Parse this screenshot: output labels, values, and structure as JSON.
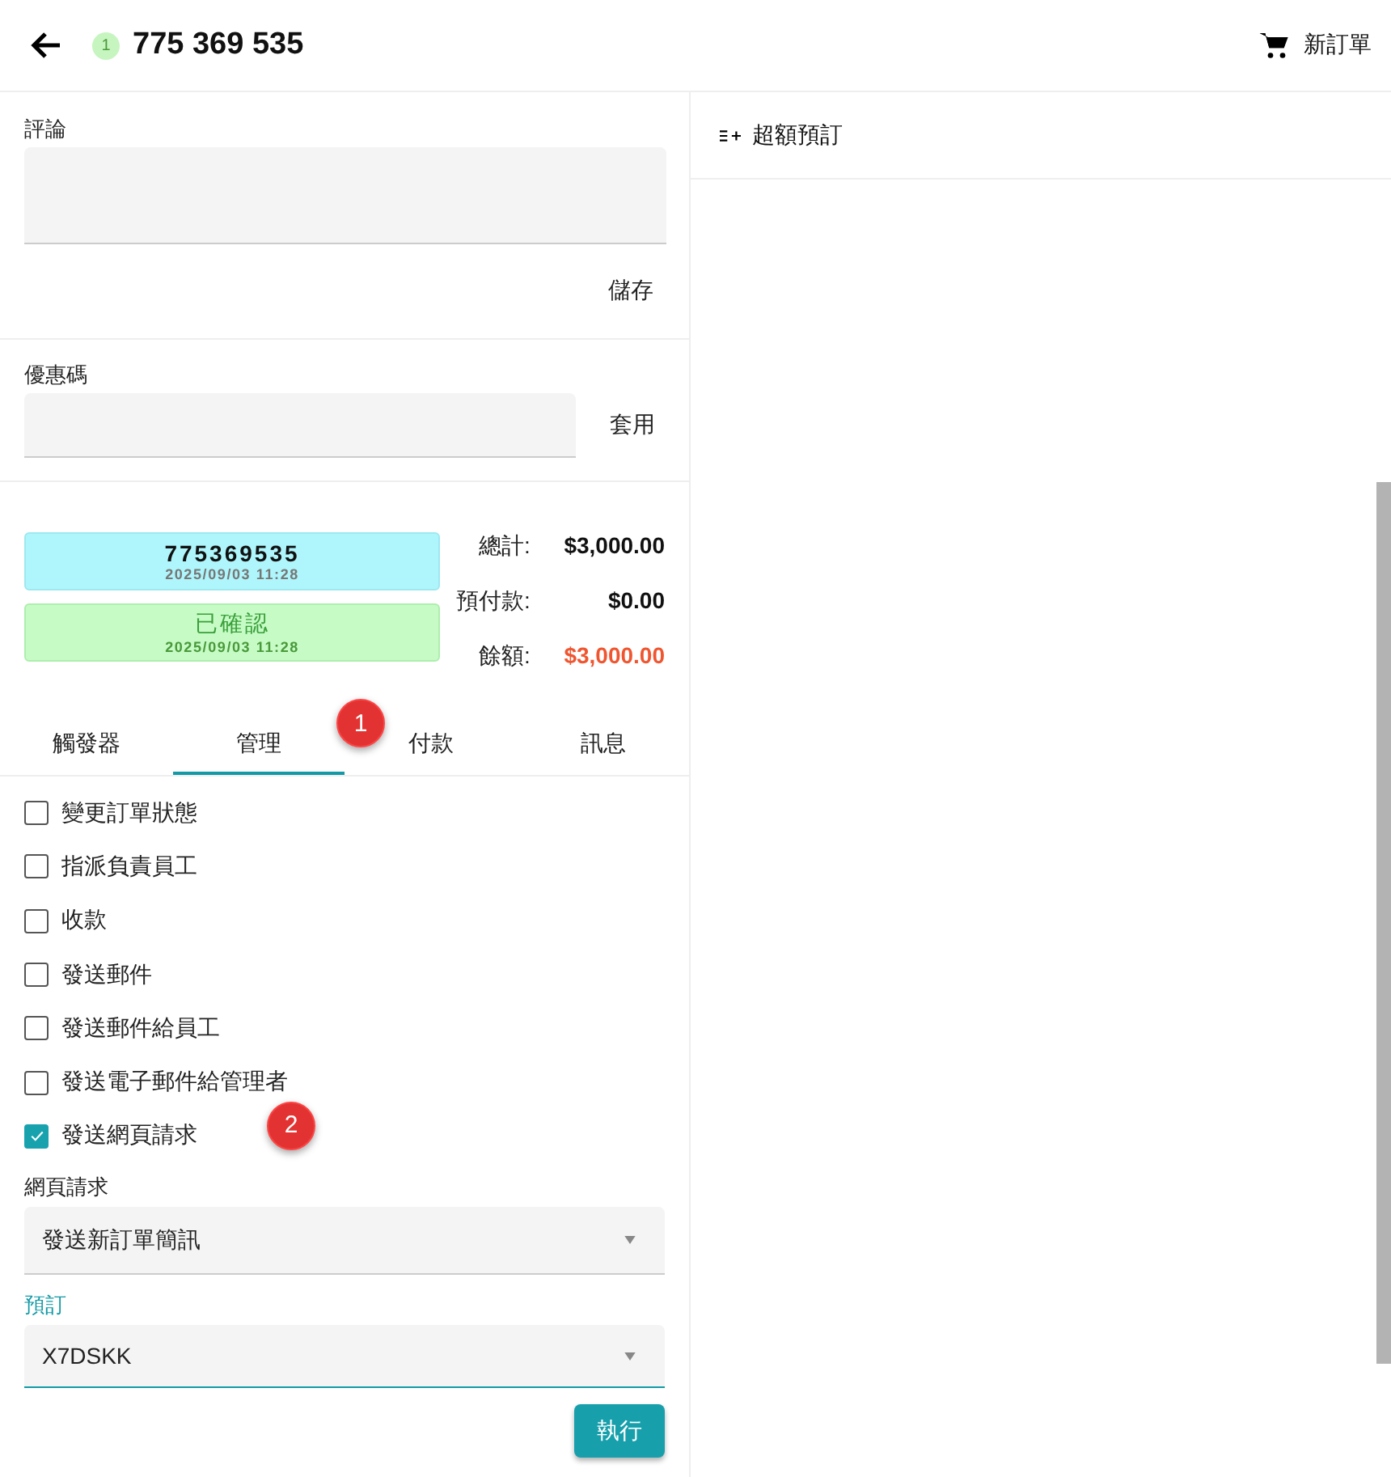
{
  "header": {
    "badge": "1",
    "title": "775 369 535",
    "new_order": "新訂單"
  },
  "comment": {
    "label": "評論",
    "save": "儲存"
  },
  "coupon": {
    "label": "優惠碼",
    "apply": "套用"
  },
  "order_cards": [
    {
      "kind": "number",
      "title": "775369535",
      "time": "2025/09/03 11:28"
    },
    {
      "kind": "status",
      "title": "已確認",
      "time": "2025/09/03 11:28"
    }
  ],
  "totals": [
    {
      "label": "總計:",
      "value": "$3,000.00",
      "kind": "normal"
    },
    {
      "label": "預付款:",
      "value": "$0.00",
      "kind": "normal"
    },
    {
      "label": "餘額:",
      "value": "$3,000.00",
      "kind": "due"
    }
  ],
  "tabs": [
    {
      "label": "觸發器",
      "selected": false
    },
    {
      "label": "管理",
      "selected": true
    },
    {
      "label": "付款",
      "selected": false
    },
    {
      "label": "訊息",
      "selected": false
    }
  ],
  "actions": [
    {
      "label": "變更訂單狀態",
      "checked": false
    },
    {
      "label": "指派負責員工",
      "checked": false
    },
    {
      "label": "收款",
      "checked": false
    },
    {
      "label": "發送郵件",
      "checked": false
    },
    {
      "label": "發送郵件給員工",
      "checked": false
    },
    {
      "label": "發送電子郵件給管理者",
      "checked": false
    },
    {
      "label": "發送網頁請求",
      "checked": true
    }
  ],
  "selects": [
    {
      "label": "網頁請求",
      "value": "發送新訂單簡訊",
      "focused": false
    },
    {
      "label": "預訂",
      "value": "X7DSKK",
      "focused": true
    }
  ],
  "run": "執行",
  "overbooking": "超額預訂",
  "annotations": [
    "1",
    "2"
  ]
}
